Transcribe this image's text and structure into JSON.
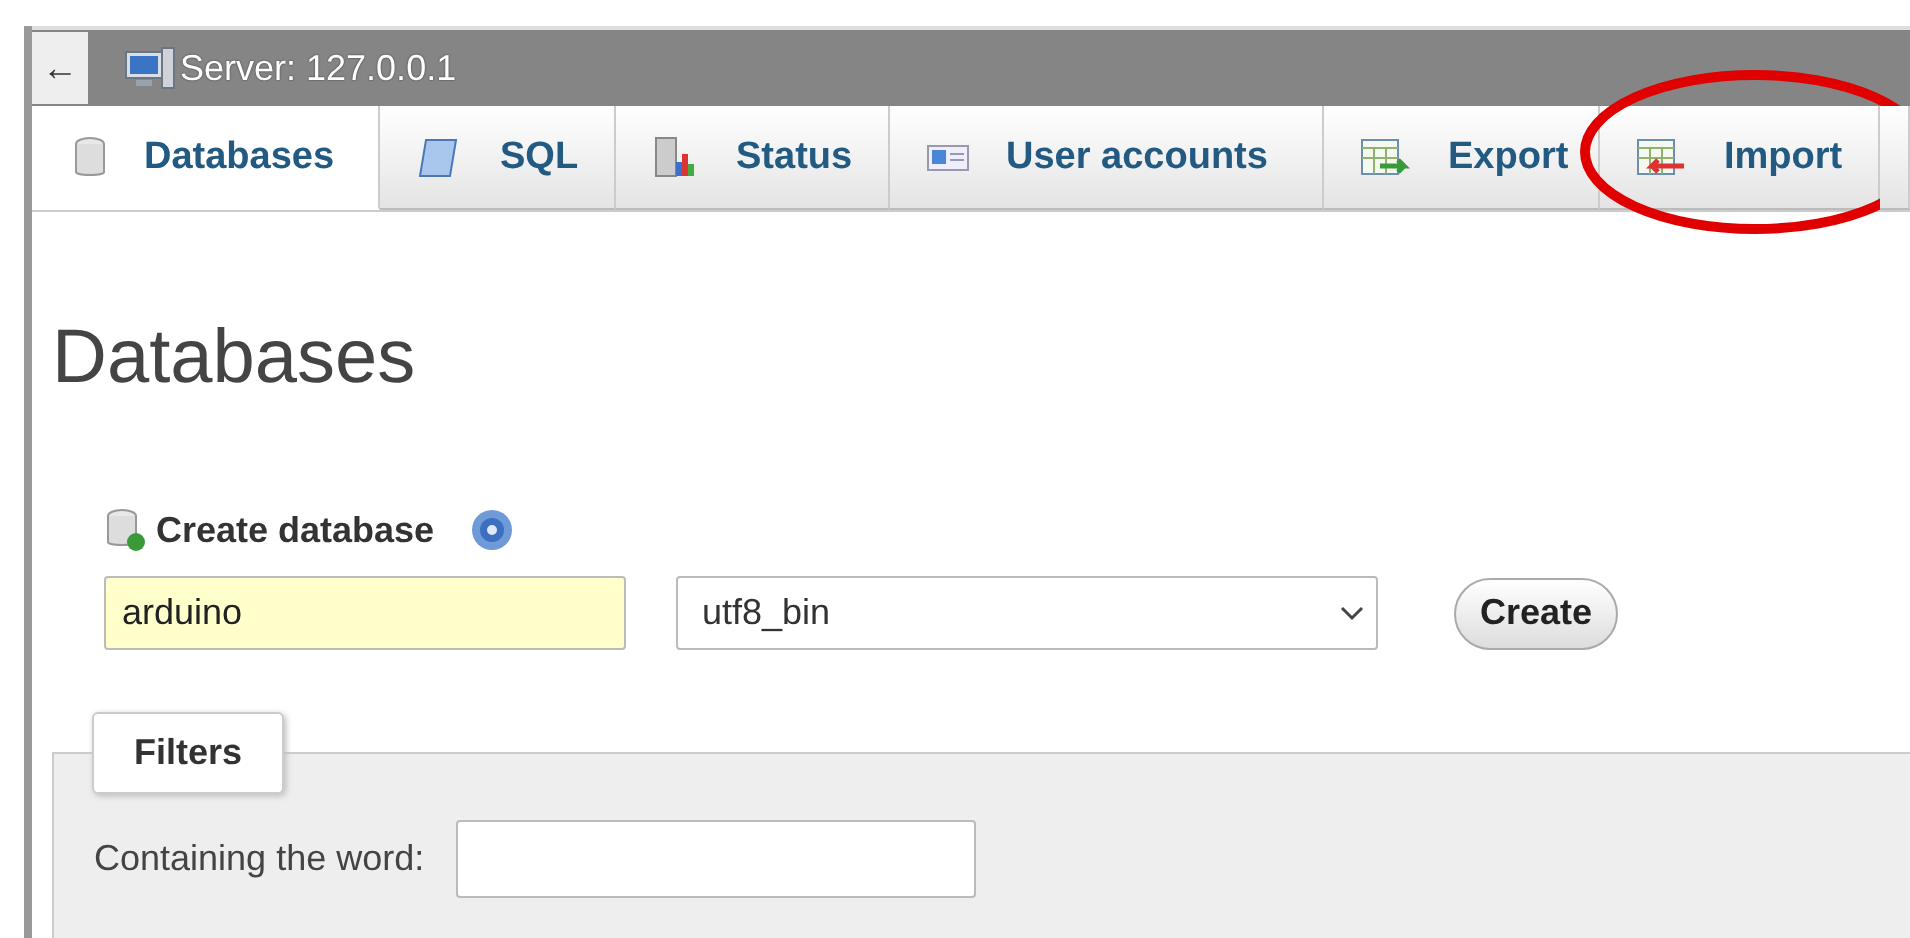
{
  "server_bar": {
    "back": "←",
    "title": "Server: 127.0.0.1"
  },
  "tabs": [
    {
      "label": "Databases",
      "kind": "database",
      "selected": true,
      "circled": false
    },
    {
      "label": "SQL",
      "kind": "sql",
      "selected": false,
      "circled": false
    },
    {
      "label": "Status",
      "kind": "status",
      "selected": false,
      "circled": false
    },
    {
      "label": "User accounts",
      "kind": "users",
      "selected": false,
      "circled": false
    },
    {
      "label": "Export",
      "kind": "export",
      "selected": false,
      "circled": false
    },
    {
      "label": "Import",
      "kind": "import",
      "selected": false,
      "circled": true
    }
  ],
  "heading": "Databases",
  "create": {
    "title": "Create database",
    "name_value": "arduino",
    "collation": "utf8_bin",
    "button": "Create"
  },
  "filters": {
    "legend": "Filters",
    "label": "Containing the word:"
  }
}
